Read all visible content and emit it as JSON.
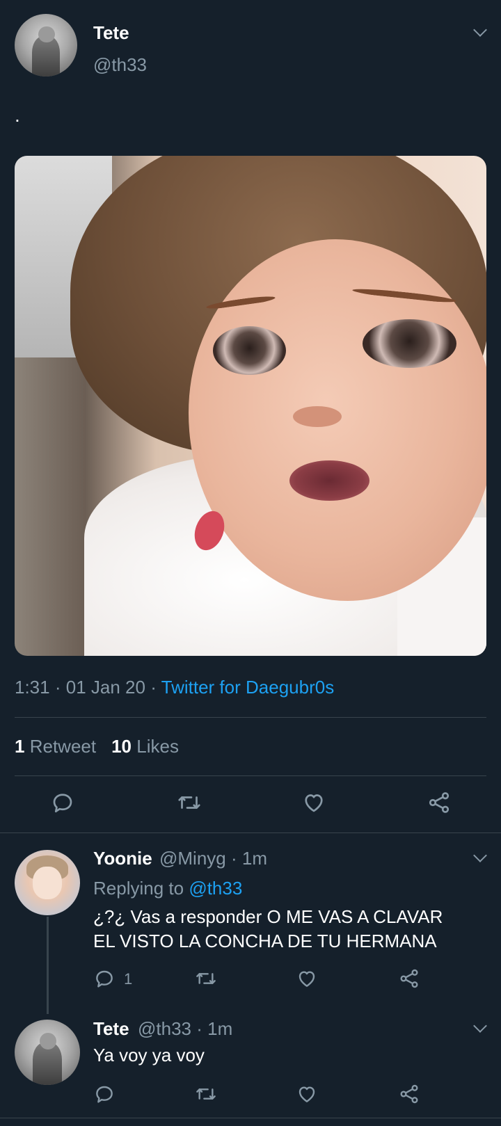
{
  "main_tweet": {
    "author_name": "Tete",
    "author_handle": "@th33",
    "text": ".",
    "time": "1:31",
    "date": "01 Jan 20",
    "source": "Twitter for Daegubr0s",
    "retweet_count": "1",
    "retweet_label": "Retweet",
    "like_count": "10",
    "like_label": "Likes"
  },
  "replies": [
    {
      "author_name": "Yoonie",
      "author_handle": "@Minyg",
      "age": "1m",
      "replying_prefix": "Replying to",
      "replying_handle": "@th33",
      "text_line1": "¿?¿ Vas a responder O ME VAS A CLAVAR",
      "text_line2": "EL VISTO LA CONCHA DE TU HERMANA",
      "reply_count": "1"
    },
    {
      "author_name": "Tete",
      "author_handle": "@th33",
      "age": "1m",
      "text": "Ya voy ya voy"
    }
  ],
  "separator": "·",
  "colors": {
    "background": "#15202b",
    "secondary_text": "#8899a6",
    "link": "#1da1f2",
    "divider": "#38444d"
  },
  "icons": [
    "chevron-down-icon",
    "reply-icon",
    "retweet-icon",
    "like-icon",
    "share-icon"
  ]
}
